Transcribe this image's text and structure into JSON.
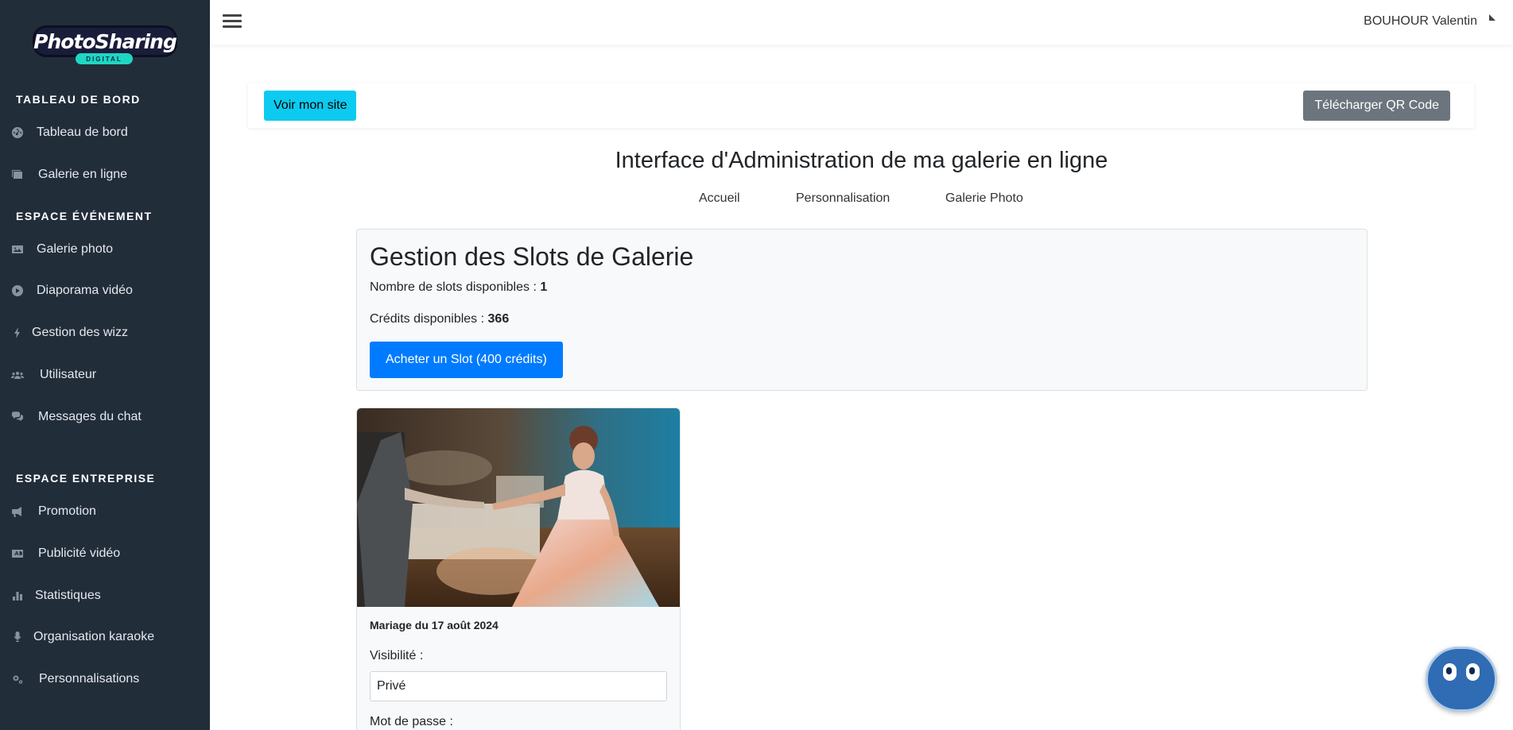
{
  "brand": {
    "logo_word": "PhotoSharing",
    "logo_sub": "DIGITAL"
  },
  "sidebar": {
    "sections": [
      {
        "title": "TABLEAU DE BORD"
      },
      {
        "title": "ESPACE ÉVÉNEMENT"
      },
      {
        "title": "ESPACE ENTREPRISE"
      }
    ],
    "items": [
      {
        "label": "Tableau de bord",
        "icon": "dashboard-gauge-icon"
      },
      {
        "label": "Galerie en ligne",
        "icon": "images-icon"
      },
      {
        "label": "Galerie photo",
        "icon": "image-icon"
      },
      {
        "label": "Diaporama vidéo",
        "icon": "play-circle-icon"
      },
      {
        "label": "Gestion des wizz",
        "icon": "bolt-icon"
      },
      {
        "label": "Utilisateur",
        "icon": "users-icon"
      },
      {
        "label": "Messages du chat",
        "icon": "comments-icon"
      },
      {
        "label": "Promotion",
        "icon": "bullhorn-icon"
      },
      {
        "label": "Publicité vidéo",
        "icon": "ad-icon"
      },
      {
        "label": "Statistiques",
        "icon": "bar-chart-icon"
      },
      {
        "label": "Organisation karaoke",
        "icon": "microphone-icon"
      },
      {
        "label": "Personnalisations",
        "icon": "cogs-icon"
      }
    ]
  },
  "topbar": {
    "user_name": "BOUHOUR Valentin"
  },
  "actions": {
    "view_site": "Voir mon site",
    "download_qr": "Télécharger QR Code"
  },
  "page": {
    "title": "Interface d'Administration de ma galerie en ligne",
    "tabs": [
      "Accueil",
      "Personnalisation",
      "Galerie Photo"
    ]
  },
  "slots": {
    "heading": "Gestion des Slots de Galerie",
    "available_label": "Nombre de slots disponibles : ",
    "available_value": "1",
    "credits_label": "Crédits disponibles : ",
    "credits_value": "366",
    "buy_button": "Acheter un Slot (400 crédits)"
  },
  "gallery": {
    "name": "Mariage du 17 août 2024",
    "visibility_label": "Visibilité :",
    "visibility_value": "Privé",
    "password_label": "Mot de passe :"
  },
  "colors": {
    "sidebar_bg": "#222d3a",
    "primary": "#007bff",
    "info": "#0dcaf0",
    "secondary": "#6c757d"
  }
}
